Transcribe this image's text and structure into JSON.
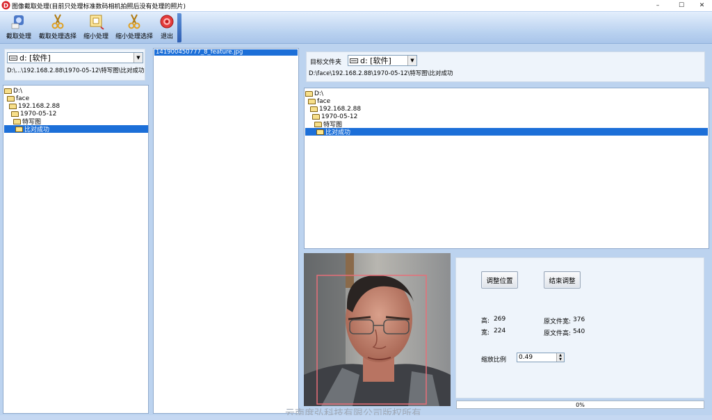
{
  "window": {
    "title": "图像截取处理(目前只处理标准数码相机拍照后没有处理的照片)",
    "controls": [
      "–",
      "☐",
      "✕"
    ]
  },
  "toolbar": {
    "items": [
      {
        "label": "截取处理",
        "icon": "crop-photo-icon"
      },
      {
        "label": "截取处理选择",
        "icon": "scissors-icon"
      },
      {
        "label": "缩小处理",
        "icon": "resize-icon"
      },
      {
        "label": "缩小处理选择",
        "icon": "scissors-select-icon"
      },
      {
        "label": "退出",
        "icon": "exit-icon"
      }
    ]
  },
  "left": {
    "drive": "d: [软件]",
    "path": "D:\\...\\192.168.2.88\\1970-05-12\\特写图\\比对成功",
    "tree": [
      {
        "label": "D:\\",
        "level": 0
      },
      {
        "label": "face",
        "level": 1
      },
      {
        "label": "192.168.2.88",
        "level": 2
      },
      {
        "label": "1970-05-12",
        "level": 3
      },
      {
        "label": "特写图",
        "level": 4
      },
      {
        "label": "比对成功",
        "level": 5,
        "selected": true
      }
    ]
  },
  "files": {
    "items": [
      "141900450777_8_feature.jpg"
    ]
  },
  "target": {
    "label": "目标文件夹",
    "drive": "d: [软件]",
    "path": "D:\\face\\192.168.2.88\\1970-05-12\\特写图\\比对成功",
    "tree": [
      {
        "label": "D:\\",
        "level": 0
      },
      {
        "label": "face",
        "level": 1
      },
      {
        "label": "192.168.2.88",
        "level": 2
      },
      {
        "label": "1970-05-12",
        "level": 3
      },
      {
        "label": "特写图",
        "level": 4
      },
      {
        "label": "比对成功",
        "level": 5,
        "selected": true
      }
    ]
  },
  "controls": {
    "adjust_label": "调整位置",
    "finish_label": "结束调整",
    "height_label": "高:",
    "height_value": "269",
    "width_label": "宽:",
    "width_value": "224",
    "orig_width_label": "原文件宽:",
    "orig_width_value": "376",
    "orig_height_label": "原文件高:",
    "orig_height_value": "540",
    "scale_label": "缩放比例",
    "scale_value": "0.49",
    "progress_percent": 0,
    "progress_text": "0%"
  },
  "footer": {
    "watermark": "云南度弘科技有限公司版权所有"
  },
  "colors": {
    "selection": "#1c6fd8",
    "crop_box": "#e86e78"
  }
}
